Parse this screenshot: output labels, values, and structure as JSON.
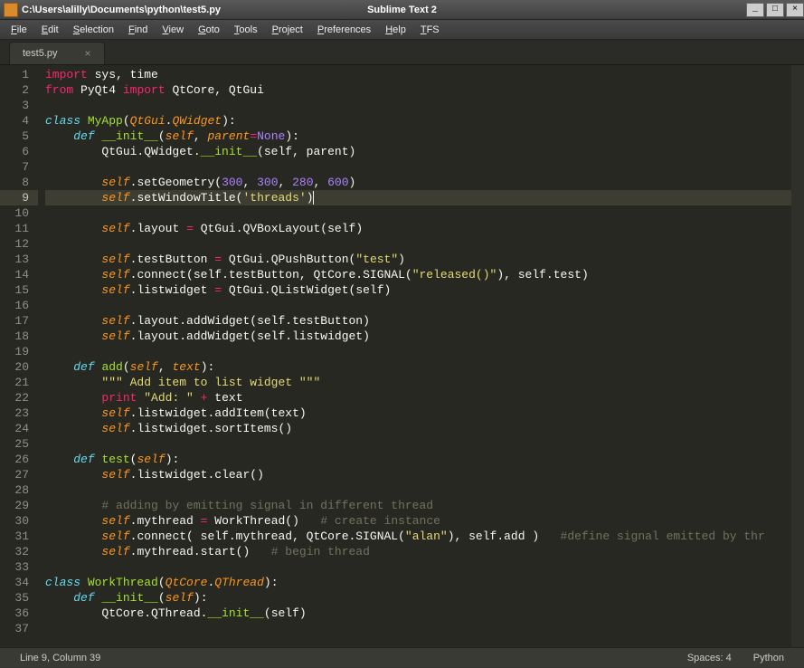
{
  "window": {
    "path": "C:\\Users\\alilly\\Documents\\python\\test5.py",
    "app_name": "Sublime Text 2",
    "min": "_",
    "max": "□",
    "close": "×"
  },
  "menu": {
    "items": [
      "File",
      "Edit",
      "Selection",
      "Find",
      "View",
      "Goto",
      "Tools",
      "Project",
      "Preferences",
      "Help",
      "TFS"
    ]
  },
  "tab": {
    "label": "test5.py",
    "close": "×"
  },
  "code_lines": [
    "<span class='kw'>import</span> <span class='pln'>sys, time</span>",
    "<span class='kw'>from</span> <span class='pln'>PyQt4 </span><span class='kw'>import</span> <span class='pln'>QtCore, QtGui</span>",
    "",
    "<span class='kw2'>class</span> <span class='nm'>MyApp</span>(<span class='arg'>QtGui</span>.<span class='arg'>QWidget</span>):",
    "    <span class='kw2'>def</span> <span class='nm'>__init__</span>(<span class='arg'>self</span>, <span class='arg'>parent</span><span class='kw'>=</span><span class='num'>None</span>):",
    "        <span class='pln'>QtGui.QWidget.</span><span class='nm'>__init__</span>(<span class='pln'>self, parent</span>)",
    "",
    "        <span class='arg'>self</span>.<span class='pln'>setGeometry(</span><span class='num'>300</span>, <span class='num'>300</span>, <span class='num'>280</span>, <span class='num'>600</span><span class='pln'>)</span>",
    "        <span class='arg'>self</span>.<span class='pln'>setWindowTitle(</span><span class='str'>'threads'</span><span class='pln'>)</span><span class='cursor'></span>",
    "",
    "        <span class='arg'>self</span>.<span class='pln'>layout </span><span class='kw'>=</span> <span class='pln'>QtGui.QVBoxLayout(self)</span>",
    "",
    "        <span class='arg'>self</span>.<span class='pln'>testButton </span><span class='kw'>=</span> <span class='pln'>QtGui.QPushButton(</span><span class='str'>\"test\"</span><span class='pln'>)</span>",
    "        <span class='arg'>self</span>.<span class='pln'>connect(self.testButton, QtCore.SIGNAL(</span><span class='str'>\"released()\"</span><span class='pln'>), self.test)</span>",
    "        <span class='arg'>self</span>.<span class='pln'>listwidget </span><span class='kw'>=</span> <span class='pln'>QtGui.QListWidget(self)</span>",
    "",
    "        <span class='arg'>self</span>.<span class='pln'>layout.addWidget(self.testButton)</span>",
    "        <span class='arg'>self</span>.<span class='pln'>layout.addWidget(self.listwidget)</span>",
    "",
    "    <span class='kw2'>def</span> <span class='nm'>add</span>(<span class='arg'>self</span>, <span class='arg'>text</span>):",
    "        <span class='str'>\"\"\" Add item to list widget \"\"\"</span>",
    "        <span class='kw'>print</span> <span class='str'>\"Add: \"</span> <span class='kw'>+</span> <span class='pln'>text</span>",
    "        <span class='arg'>self</span>.<span class='pln'>listwidget.addItem(text)</span>",
    "        <span class='arg'>self</span>.<span class='pln'>listwidget.sortItems()</span>",
    "",
    "    <span class='kw2'>def</span> <span class='nm'>test</span>(<span class='arg'>self</span>):",
    "        <span class='arg'>self</span>.<span class='pln'>listwidget.clear()</span>",
    "",
    "        <span class='cmt'># adding by emitting signal in different thread</span>",
    "        <span class='arg'>self</span>.<span class='pln'>mythread </span><span class='kw'>=</span> <span class='pln'>WorkThread()</span>   <span class='cmt'># create instance</span>",
    "        <span class='arg'>self</span>.<span class='pln'>connect( self.mythread, QtCore.SIGNAL(</span><span class='str'>\"alan\"</span><span class='pln'>), self.add )</span>   <span class='cmt'>#define signal emitted by thr</span>",
    "        <span class='arg'>self</span>.<span class='pln'>mythread.start()</span>   <span class='cmt'># begin thread</span>",
    "",
    "<span class='kw2'>class</span> <span class='nm'>WorkThread</span>(<span class='arg'>QtCore</span>.<span class='arg'>QThread</span>):",
    "    <span class='kw2'>def</span> <span class='nm'>__init__</span>(<span class='arg'>self</span>):",
    "        <span class='pln'>QtCore.QThread.</span><span class='nm'>__init__</span>(<span class='pln'>self</span>)",
    ""
  ],
  "current_line_index": 8,
  "status": {
    "position": "Line 9, Column 39",
    "spaces": "Spaces: 4",
    "syntax": "Python"
  }
}
